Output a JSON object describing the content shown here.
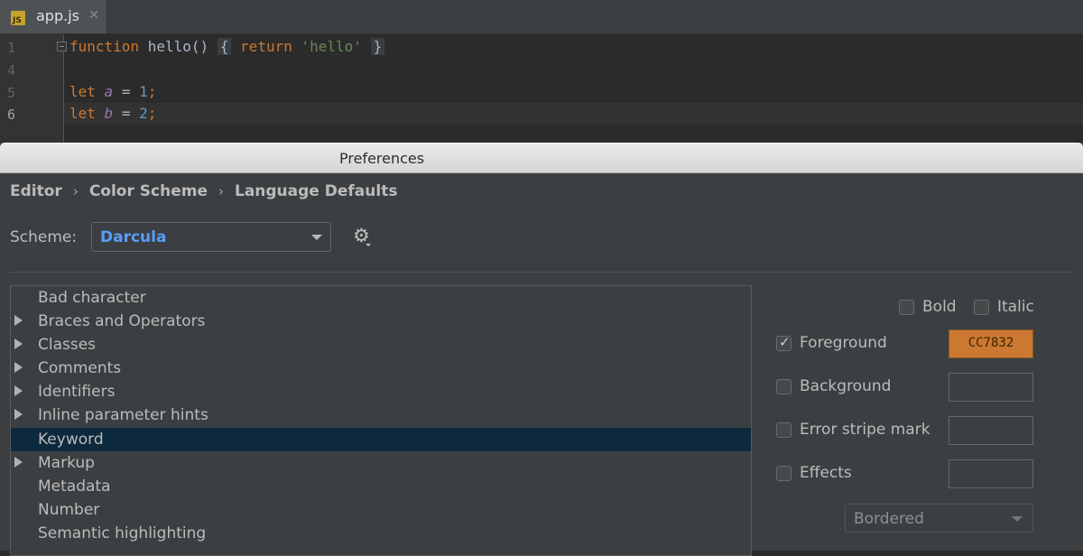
{
  "editor": {
    "tab": {
      "label": "app.js",
      "icon": "javascript-file-icon",
      "icon_text": "JS"
    },
    "lines": [
      {
        "number": "1",
        "kw": "function",
        "name": " hello()",
        "pre_brace": " ",
        "brace_open": "{",
        "space": " ",
        "ret": "return",
        "str": "'hello'",
        "brace_close": "}"
      },
      {
        "number": "4"
      },
      {
        "number": "5",
        "kw": "let",
        "var": "a",
        "op": " = ",
        "num": "1",
        "end": ";"
      },
      {
        "number": "6",
        "kw": "let",
        "var": "b",
        "op": " = ",
        "num": "2",
        "end": ";"
      }
    ]
  },
  "dialog": {
    "title": "Preferences",
    "breadcrumb": [
      "Editor",
      "Color Scheme",
      "Language Defaults"
    ],
    "scheme": {
      "label": "Scheme:",
      "value": "Darcula"
    },
    "tree_items": [
      {
        "label": "Bad character",
        "expandable": false,
        "selected": false
      },
      {
        "label": "Braces and Operators",
        "expandable": true,
        "selected": false
      },
      {
        "label": "Classes",
        "expandable": true,
        "selected": false
      },
      {
        "label": "Comments",
        "expandable": true,
        "selected": false
      },
      {
        "label": "Identifiers",
        "expandable": true,
        "selected": false
      },
      {
        "label": "Inline parameter hints",
        "expandable": true,
        "selected": false
      },
      {
        "label": "Keyword",
        "expandable": false,
        "selected": true
      },
      {
        "label": "Markup",
        "expandable": true,
        "selected": false
      },
      {
        "label": "Metadata",
        "expandable": false,
        "selected": false
      },
      {
        "label": "Number",
        "expandable": false,
        "selected": false
      },
      {
        "label": "Semantic highlighting",
        "expandable": false,
        "selected": false
      }
    ],
    "options": {
      "bold": {
        "label": "Bold",
        "checked": false
      },
      "italic": {
        "label": "Italic",
        "checked": false
      },
      "foreground": {
        "label": "Foreground",
        "checked": true,
        "color": "CC7832"
      },
      "background": {
        "label": "Background",
        "checked": false
      },
      "error_stripe": {
        "label": "Error stripe mark",
        "checked": false
      },
      "effects": {
        "label": "Effects",
        "checked": false,
        "type": "Bordered"
      }
    }
  },
  "colors": {
    "keyword": "#cc7832",
    "selection": "#0d293e",
    "link_blue": "#589df6",
    "background": "#3c3f41"
  }
}
